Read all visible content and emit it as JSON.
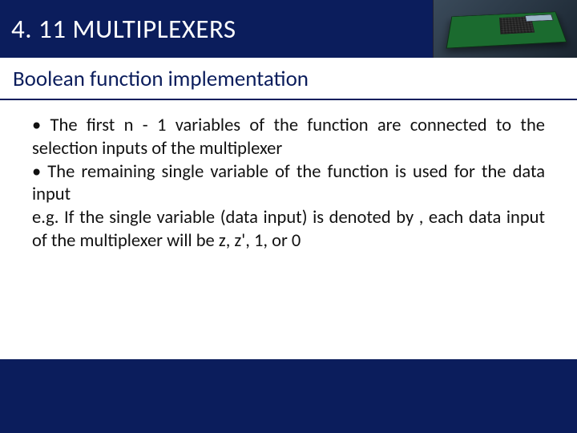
{
  "slide": {
    "title": "4. 11 MULTIPLEXERS",
    "subtitle": "Boolean function implementation",
    "bullets": [
      "• The first n - 1 variables of the function are connected to the selection inputs of the multiplexer",
      "• The remaining single variable of the function is used for the data input",
      "e.g. If the single variable (data input) is denoted by , each data input of the multiplexer will be z, z', 1, or 0"
    ]
  }
}
